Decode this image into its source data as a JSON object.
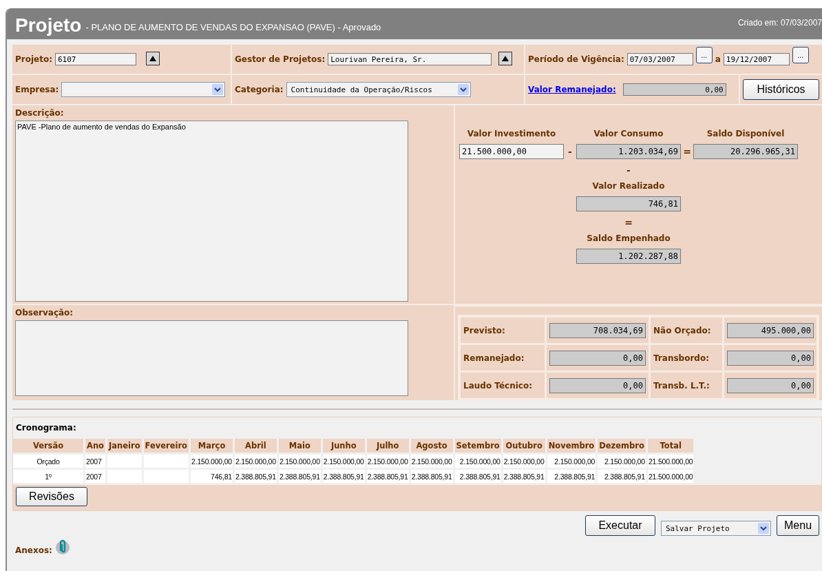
{
  "header": {
    "title": "Projeto",
    "subtitle": "- PLANO DE AUMENTO DE VENDAS DO EXPANSAO (PAVE) - Aprovado",
    "created": "Criado em: 07/03/2007"
  },
  "form": {
    "projeto": {
      "label": "Projeto:",
      "value": "6107"
    },
    "gestor": {
      "label": "Gestor de Projetos:",
      "value": "Lourivan Pereira, Sr."
    },
    "periodo": {
      "label": "Período de Vigência:",
      "start": "07/03/2007",
      "start_button": "...",
      "separator": "a",
      "end": "19/12/2007",
      "end_button": "..."
    },
    "empresa": {
      "label": "Empresa:"
    },
    "categoria": {
      "label": "Categoria:",
      "value": "Continuidade da Operação/Riscos"
    },
    "remanejado": {
      "label": "Valor Remanejado:",
      "value": "0,00"
    },
    "historicos_button": "Históricos"
  },
  "descricao": {
    "label": "Descrição:",
    "value": "PAVE -Plano de aumento de vendas do Expansão"
  },
  "observacao": {
    "label": "Observação:"
  },
  "calculo": {
    "investimento": {
      "label": "Valor Investimento",
      "value": "21.500.000,00"
    },
    "minus": "-",
    "consumo": {
      "label": "Valor Consumo",
      "value": "1.203.034,69"
    },
    "equals": "=",
    "disponivel": {
      "label": "Saldo Disponível",
      "value": "20.296.965,31"
    },
    "minus2": "-",
    "realizado": {
      "label": "Valor Realizado",
      "value": "746,81"
    },
    "equals2": "=",
    "empenhado": {
      "label": "Saldo Empenhado",
      "value": "1.202.287,88"
    }
  },
  "resumo": [
    {
      "label": "Previsto:",
      "value": "708.034,69"
    },
    {
      "label": "Não Orçado:",
      "value": "495.000,00"
    },
    {
      "label": "Remanejado:",
      "value": "0,00"
    },
    {
      "label": "Transbordo:",
      "value": "0,00"
    },
    {
      "label": "Laudo Técnico:",
      "value": "0,00"
    },
    {
      "label": "Transb. L.T.:",
      "value": "0,00"
    }
  ],
  "cronograma": {
    "title": "Cronograma:",
    "columns": [
      "Versão",
      "Ano",
      "Janeiro",
      "Fevereiro",
      "Março",
      "Abril",
      "Maio",
      "Junho",
      "Julho",
      "Agosto",
      "Setembro",
      "Outubro",
      "Novembro",
      "Dezembro",
      "Total"
    ],
    "rows": [
      {
        "cells": [
          "Orçado",
          "2007",
          null,
          null,
          "2.150.000,00",
          "2.150.000,00",
          "2.150.000,00",
          "2.150.000,00",
          "2.150.000,00",
          "2.150.000,00",
          "2.150.000,00",
          "2.150.000,00",
          "2.150.000,00",
          "2.150.000,00",
          "21.500.000,00"
        ]
      },
      {
        "cells": [
          "1º",
          "2007",
          null,
          null,
          "746,81",
          "2.388.805,91",
          "2.388.805,91",
          "2.388.805,91",
          "2.388.805,91",
          "2.388.805,91",
          "2.388.805,91",
          "2.388.805,91",
          "2.388.805,91",
          "2.388.805,91",
          "21.500.000,00"
        ]
      }
    ],
    "revisoes_button": "Revisões"
  },
  "actions": {
    "execute_button": "Executar",
    "action_select": "Salvar Projeto",
    "menu_button": "Menu"
  },
  "anexos": {
    "label": "Anexos:"
  }
}
